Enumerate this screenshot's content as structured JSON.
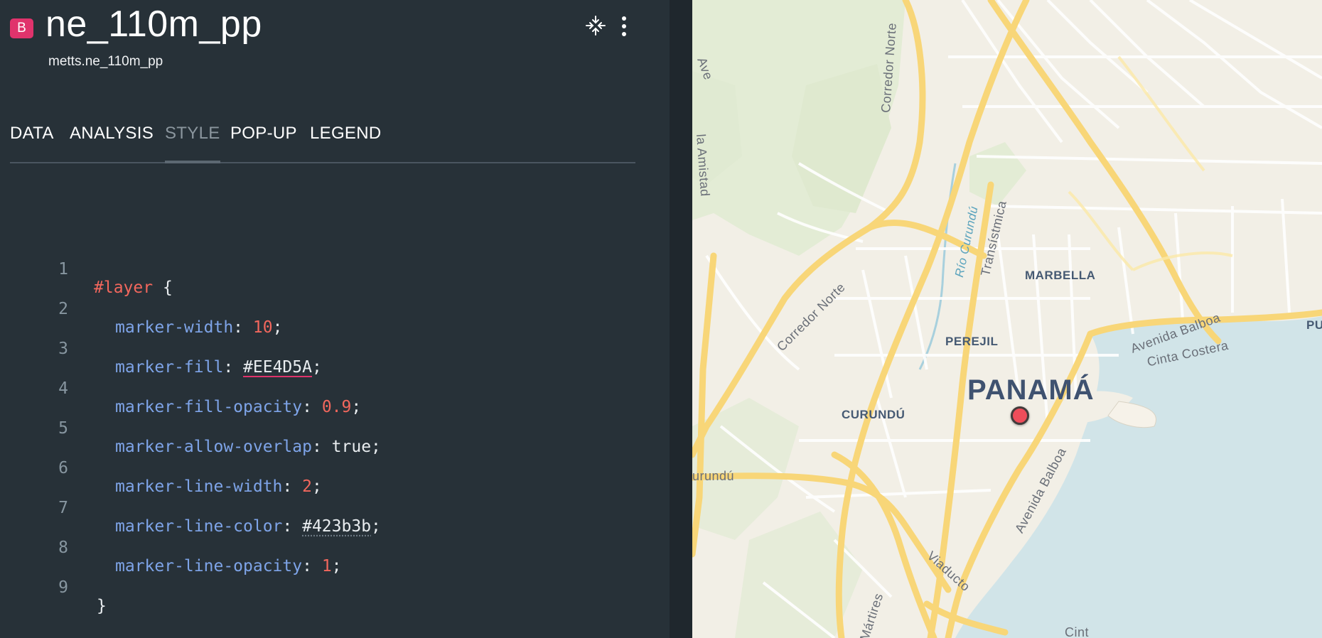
{
  "layer": {
    "badge": "B",
    "title": "ne_110m_pp",
    "subtitle": "metts.ne_110m_pp",
    "badge_color": "#e0336c"
  },
  "header_actions": {
    "collapse_icon": "collapse-arrows-icon",
    "more_icon": "more-vertical-icon"
  },
  "tabs": [
    {
      "label": "DATA",
      "active": false
    },
    {
      "label": "ANALYSIS",
      "active": false
    },
    {
      "label": "STYLE",
      "active": true
    },
    {
      "label": "POP-UP",
      "active": false
    },
    {
      "label": "LEGEND",
      "active": false
    }
  ],
  "code": {
    "lines": [
      {
        "n": "1",
        "selector": "#layer",
        "brace": " {"
      },
      {
        "n": "2",
        "prop": "marker-width",
        "value": "10",
        "kind": "num"
      },
      {
        "n": "3",
        "prop": "marker-fill",
        "value": "#EE4D5A",
        "kind": "color-red"
      },
      {
        "n": "4",
        "prop": "marker-fill-opacity",
        "value": "0.9",
        "kind": "num"
      },
      {
        "n": "5",
        "prop": "marker-allow-overlap",
        "value": "true",
        "kind": "plain"
      },
      {
        "n": "6",
        "prop": "marker-line-width",
        "value": "2",
        "kind": "num"
      },
      {
        "n": "7",
        "prop": "marker-line-color",
        "value": "#423b3b",
        "kind": "color-dark"
      },
      {
        "n": "8",
        "prop": "marker-line-opacity",
        "value": "1",
        "kind": "num"
      },
      {
        "n": "9",
        "close": "}"
      }
    ]
  },
  "map": {
    "labels": {
      "marbella": "MARBELLA",
      "perejil": "PEREJIL",
      "curundu": "CURUNDÚ",
      "panama": "PANAMÁ",
      "pu": "PU",
      "corredor_norte_vertical": "Corredor Norte",
      "corredor_norte_diag": "Corredor Norte",
      "transistmica": "Transístmica",
      "rio_curundu": "Río Curundú",
      "avenida_balboa_top": "Avenida Balboa",
      "cinta_costera_top": "Cinta Costera",
      "avenida_balboa_side": "Avenida Balboa",
      "viaducto": "Viaducto",
      "amistad": "la Amistad",
      "ave": "Ave",
      "curundu_road": "urundú",
      "martires": "Mártires",
      "cinta_bottom": "Cint"
    },
    "marker_fill": "#EE4D5A",
    "marker_line": "#423b3b",
    "water_color": "#d1e4e8",
    "land_color": "#f2efe6",
    "park_color": "#e3ecd5",
    "road_color": "#f8d678"
  }
}
